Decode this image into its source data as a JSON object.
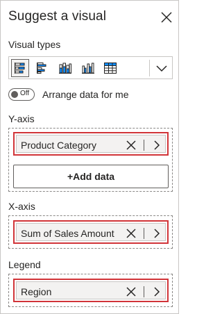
{
  "header": {
    "title": "Suggest a visual"
  },
  "visual_types": {
    "label": "Visual types",
    "items": [
      {
        "icon": "stacked-bar-chart-icon",
        "selected": true
      },
      {
        "icon": "clustered-bar-chart-icon",
        "selected": false
      },
      {
        "icon": "stacked-column-chart-icon",
        "selected": false
      },
      {
        "icon": "clustered-column-chart-icon",
        "selected": false
      },
      {
        "icon": "table-icon",
        "selected": false
      }
    ]
  },
  "arrange": {
    "toggle_text": "Off",
    "label": "Arrange data for me"
  },
  "y_axis": {
    "label": "Y-axis",
    "field": "Product Category",
    "add_label": "+Add data"
  },
  "x_axis": {
    "label": "X-axis",
    "field": "Sum of Sales Amount"
  },
  "legend": {
    "label": "Legend",
    "field": "Region"
  },
  "colors": {
    "highlight": "#d13438",
    "accent": "#118dff",
    "text": "#252423",
    "border": "#c8c6c4"
  }
}
